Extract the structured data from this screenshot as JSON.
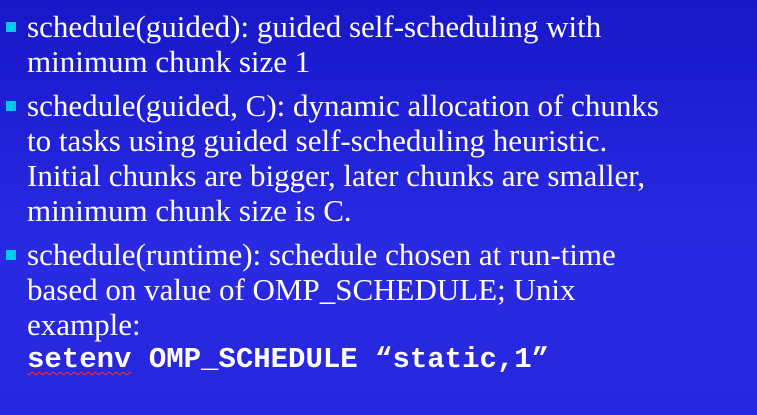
{
  "slide": {
    "bullets": [
      {
        "lines": [
          "schedule(guided): guided self-scheduling with",
          "minimum chunk size 1"
        ]
      },
      {
        "lines": [
          "schedule(guided, C): dynamic allocation of chunks",
          "to tasks using guided self-scheduling heuristic.",
          "Initial chunks are bigger, later chunks are smaller,",
          "minimum chunk size is C."
        ]
      },
      {
        "lines": [
          "schedule(runtime): schedule chosen at run-time",
          "based on value of OMP_SCHEDULE; Unix",
          "example:"
        ],
        "code": {
          "command": "setenv",
          "rest": " OMP_SCHEDULE “static,1”"
        }
      }
    ]
  },
  "colors": {
    "background": "#2222d8",
    "text": "#ffffff",
    "bullet": "#00c8e8",
    "spellcheck_underline": "#ff3030"
  }
}
